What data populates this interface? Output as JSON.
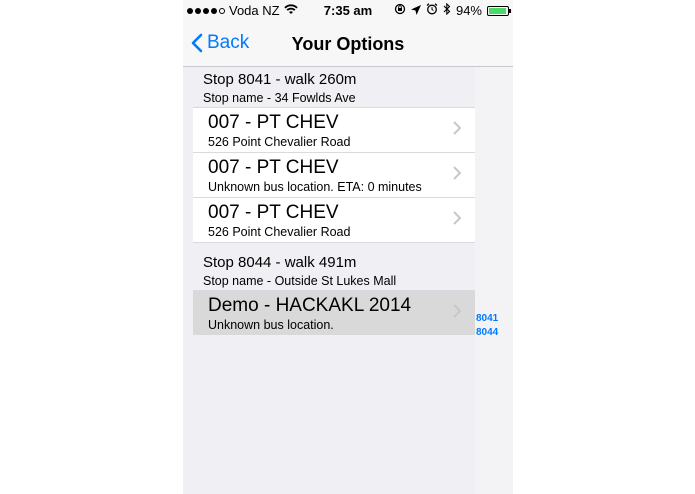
{
  "status": {
    "carrier": "Voda NZ",
    "time": "7:35 am",
    "battery": "94%",
    "battery_level": 0.94,
    "icons": [
      "signal-dots",
      "wifi-icon",
      "lock-rotation-icon",
      "location-icon",
      "alarm-icon",
      "bluetooth-icon",
      "battery-icon"
    ]
  },
  "nav": {
    "back_label": "Back",
    "title": "Your Options"
  },
  "sections": [
    {
      "title": "Stop 8041 - walk 260m",
      "subtitle": "Stop name - 34 Fowlds Ave",
      "rows": [
        {
          "title": "007 - PT CHEV",
          "subtitle": "526 Point Chevalier Road"
        },
        {
          "title": "007 - PT CHEV",
          "subtitle": "Unknown bus location. ETA: 0 minutes"
        },
        {
          "title": "007 - PT CHEV",
          "subtitle": "526 Point Chevalier Road"
        }
      ]
    },
    {
      "title": "Stop 8044 - walk 491m",
      "subtitle": "Stop name - Outside St Lukes Mall",
      "rows": [
        {
          "title": "Demo - HACKAKL 2014",
          "subtitle": "Unknown bus location.",
          "selected": true
        }
      ]
    }
  ],
  "index": [
    "8041",
    "8044"
  ],
  "colors": {
    "accent": "#007aff",
    "background": "#efeff4",
    "battery": "#4cd964",
    "selected_row": "#d9d9d9"
  }
}
